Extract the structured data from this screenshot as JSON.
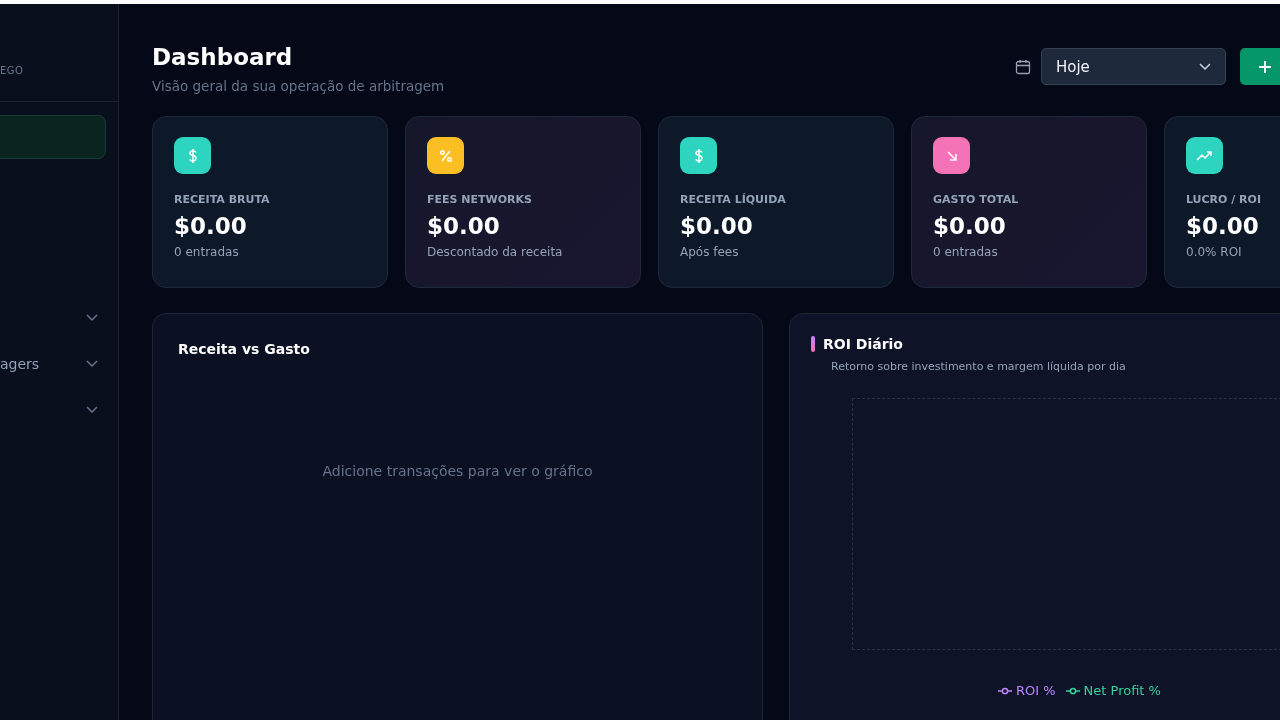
{
  "sidebar": {
    "section_label": "EGO",
    "active_item": {
      "selected": true
    },
    "groups": [
      {
        "expanded": false
      },
      {
        "label": "agers",
        "expanded": false
      },
      {
        "expanded": false
      }
    ]
  },
  "header": {
    "title": "Dashboard",
    "subtitle": "Visão geral da sua operação de arbitragem",
    "period": {
      "value": "Hoje"
    }
  },
  "stats": [
    {
      "kind": "dollar",
      "color": "#2dd4bf",
      "label": "RECEITA BRUTA",
      "value": "$0.00",
      "note": "0 entradas"
    },
    {
      "kind": "percent",
      "color": "#fbbf24",
      "label": "FEES NETWORKS",
      "value": "$0.00",
      "note": "Descontado da receita"
    },
    {
      "kind": "dollar",
      "color": "#2dd4bf",
      "label": "RECEITA LÍQUIDA",
      "value": "$0.00",
      "note": "Após fees"
    },
    {
      "kind": "decrease",
      "color": "#f472b6",
      "label": "GASTO TOTAL",
      "value": "$0.00",
      "note": "0 entradas"
    },
    {
      "kind": "profit",
      "color": "#2dd4bf",
      "label": "LUCRO / ROI",
      "value": "$0.00",
      "note": "0.0% ROI"
    }
  ],
  "revenue_chart": {
    "title": "Receita vs Gasto",
    "empty_message": "Adicione transações para ver o gráfico"
  },
  "roi_chart": {
    "title": "ROI Diário",
    "subtitle": "Retorno sobre investimento e margem líquida por dia",
    "legend": [
      {
        "label": "ROI %",
        "color": "#c084fc"
      },
      {
        "label": "Net Profit %",
        "color": "#34d399"
      }
    ]
  }
}
